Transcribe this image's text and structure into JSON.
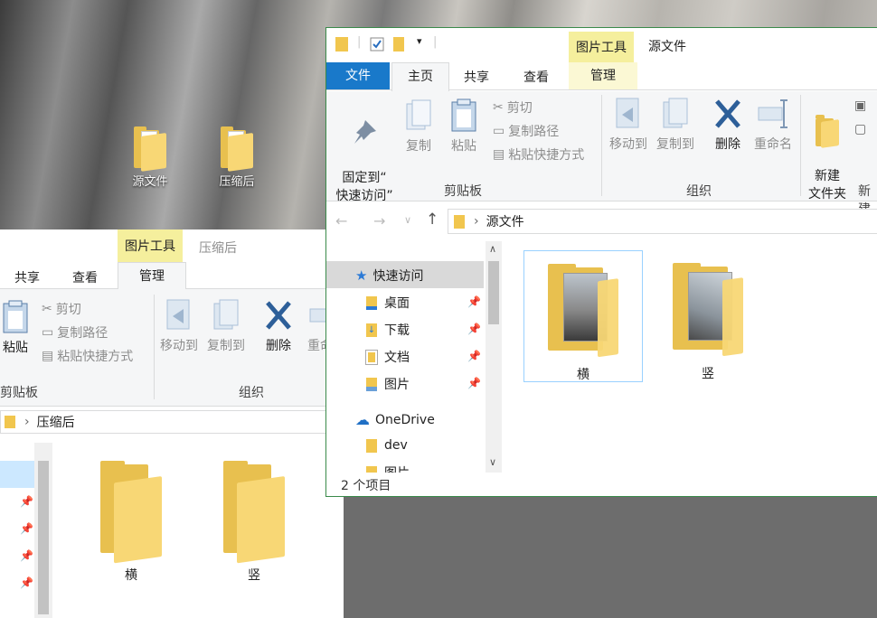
{
  "desktop": {
    "icons": [
      {
        "label": "源文件"
      },
      {
        "label": "压缩后"
      }
    ]
  },
  "back_window": {
    "context_group": "图片工具",
    "context_title": "压缩后",
    "tabs": [
      "共享",
      "查看",
      "管理"
    ],
    "clipboard": {
      "paste": "粘贴",
      "cut": "剪切",
      "copy_path": "复制路径",
      "paste_shortcut": "粘贴快捷方式",
      "group_label": "剪贴板"
    },
    "organize": {
      "move_to": "移动到",
      "copy_to": "复制到",
      "delete": "删除",
      "rename": "重命",
      "group_label": "组织"
    },
    "address": {
      "path": "压缩后"
    },
    "files": [
      {
        "name": "横"
      },
      {
        "name": "竖"
      }
    ],
    "pins": [
      "📌",
      "📌",
      "📌",
      "📌"
    ]
  },
  "front_window": {
    "qat": {
      "title": "源文件"
    },
    "context_group": "图片工具",
    "tabs": [
      "文件",
      "主页",
      "共享",
      "查看",
      "管理"
    ],
    "clipboard": {
      "pin_quick": "固定到“\n快速访问”",
      "copy": "复制",
      "paste": "粘贴",
      "cut": "剪切",
      "copy_path": "复制路径",
      "paste_shortcut": "粘贴快捷方式",
      "group_label": "剪贴板"
    },
    "organize": {
      "move_to": "移动到",
      "copy_to": "复制到",
      "delete": "删除",
      "rename": "重命名",
      "group_label": "组织"
    },
    "new": {
      "new_folder": "新建\n文件夹",
      "group_label": "新建"
    },
    "address": {
      "path": "源文件"
    },
    "nav": [
      {
        "label": "快速访问",
        "icon": "star-icon"
      },
      {
        "label": "桌面",
        "icon": "desktop-folder-icon",
        "pinned": true
      },
      {
        "label": "下载",
        "icon": "download-folder-icon",
        "pinned": true
      },
      {
        "label": "文档",
        "icon": "documents-folder-icon",
        "pinned": true
      },
      {
        "label": "图片",
        "icon": "pictures-folder-icon",
        "pinned": true
      },
      {
        "label": "OneDrive",
        "icon": "cloud-icon"
      },
      {
        "label": "dev",
        "icon": "folder-icon"
      },
      {
        "label": "图片",
        "icon": "folder-icon"
      }
    ],
    "files": [
      {
        "name": "横"
      },
      {
        "name": "竖"
      }
    ],
    "status": "2 个项目"
  }
}
